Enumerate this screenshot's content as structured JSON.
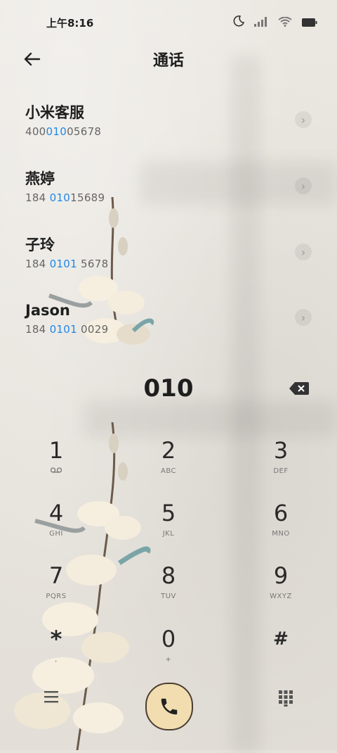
{
  "status": {
    "time": "上午8:16",
    "icons": [
      "moon-icon",
      "signal-icon",
      "wifi-icon",
      "battery-icon"
    ]
  },
  "header": {
    "title": "通话"
  },
  "contacts": [
    {
      "name": "小米客服",
      "num_pre": "400",
      "num_hl": "010",
      "num_post": "05678"
    },
    {
      "name": "燕婷",
      "num_pre": "184 ",
      "num_hl": "010",
      "num_post": "15689"
    },
    {
      "name": "子玲",
      "num_pre": "184 ",
      "num_hl": "0101",
      "num_post": " 5678"
    },
    {
      "name": "Jason",
      "num_pre": "184 ",
      "num_hl": "0101",
      "num_post": " 0029"
    }
  ],
  "dialed": "010",
  "keys": [
    {
      "digit": "1",
      "letters": ""
    },
    {
      "digit": "2",
      "letters": "ABC"
    },
    {
      "digit": "3",
      "letters": "DEF"
    },
    {
      "digit": "4",
      "letters": "GHI"
    },
    {
      "digit": "5",
      "letters": "JKL"
    },
    {
      "digit": "6",
      "letters": "MNO"
    },
    {
      "digit": "7",
      "letters": "PQRS"
    },
    {
      "digit": "8",
      "letters": "TUV"
    },
    {
      "digit": "9",
      "letters": "WXYZ"
    },
    {
      "digit": "*",
      "letters": ","
    },
    {
      "digit": "0",
      "letters": "+"
    },
    {
      "digit": "#",
      "letters": ""
    }
  ],
  "colors": {
    "accent_blue": "#1e88e5",
    "call_fill": "#f2ddb0"
  }
}
